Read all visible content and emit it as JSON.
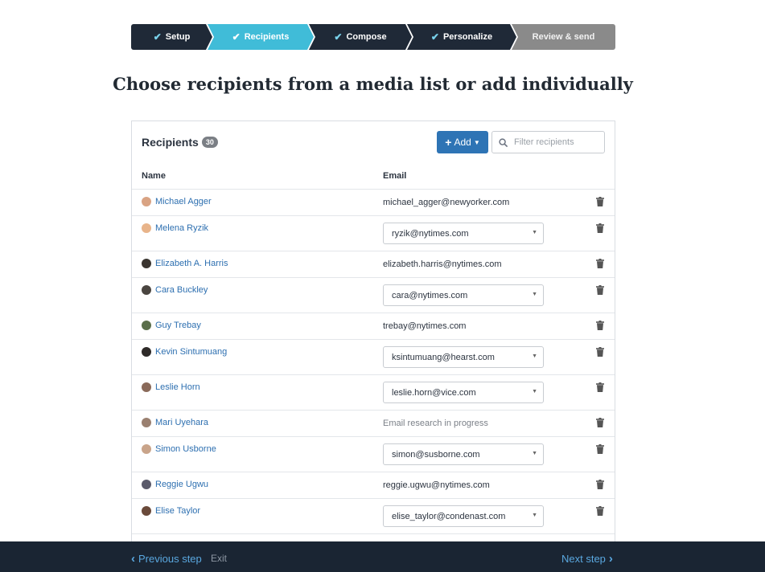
{
  "stepper": {
    "steps": [
      {
        "label": "Setup",
        "state": "done"
      },
      {
        "label": "Recipients",
        "state": "active"
      },
      {
        "label": "Compose",
        "state": "done"
      },
      {
        "label": "Personalize",
        "state": "done"
      },
      {
        "label": "Review & send",
        "state": "pending"
      }
    ],
    "check_glyph": "✔"
  },
  "page": {
    "title": "Choose recipients from a media list or add individually"
  },
  "recipients": {
    "title": "Recipients",
    "count": "30",
    "add_label": "Add",
    "add_plus": "+",
    "filter_placeholder": "Filter recipients",
    "columns": {
      "name": "Name",
      "email": "Email"
    },
    "rows": [
      {
        "name": "Michael Agger",
        "email": "michael_agger@newyorker.com",
        "type": "text"
      },
      {
        "name": "Melena Ryzik",
        "email": "ryzik@nytimes.com",
        "type": "select"
      },
      {
        "name": "Elizabeth A. Harris",
        "email": "elizabeth.harris@nytimes.com",
        "type": "text"
      },
      {
        "name": "Cara Buckley",
        "email": "cara@nytimes.com",
        "type": "select"
      },
      {
        "name": "Guy Trebay",
        "email": "trebay@nytimes.com",
        "type": "text"
      },
      {
        "name": "Kevin Sintumuang",
        "email": "ksintumuang@hearst.com",
        "type": "select"
      },
      {
        "name": "Leslie Horn",
        "email": "leslie.horn@vice.com",
        "type": "select"
      },
      {
        "name": "Mari Uyehara",
        "email": "Email research in progress",
        "type": "muted"
      },
      {
        "name": "Simon Usborne",
        "email": "simon@susborne.com",
        "type": "select"
      },
      {
        "name": "Reggie Ugwu",
        "email": "reggie.ugwu@nytimes.com",
        "type": "text"
      },
      {
        "name": "Elise Taylor",
        "email": "elise_taylor@condenast.com",
        "type": "select"
      }
    ]
  },
  "footer": {
    "prev_label": "Previous step",
    "exit_label": "Exit",
    "next_label": "Next step"
  },
  "colors": {
    "active_step": "#40bcd8",
    "done_step": "#1f2937",
    "pending_step": "#8a8a8a",
    "primary": "#2e74b5",
    "link": "#2d6fb0",
    "footer_bg": "#1a2533"
  },
  "icons": [
    "check-icon",
    "plus-icon",
    "caret-down-icon",
    "search-icon",
    "trash-icon",
    "chevron-left-icon",
    "chevron-right-icon",
    "avatar"
  ]
}
